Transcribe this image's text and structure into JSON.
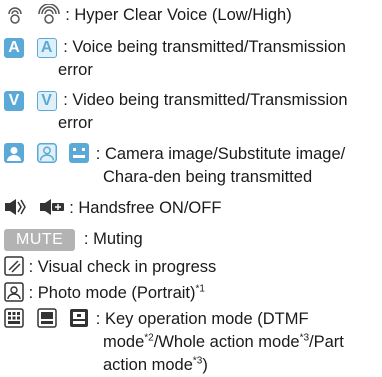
{
  "items": [
    {
      "icon_names": [
        "hyper-clear-voice-low-icon",
        "hyper-clear-voice-high-icon"
      ],
      "text": ": Hyper Clear Voice (Low/High)"
    },
    {
      "icon_names": [
        "voice-transmitted-icon",
        "transmission-error-a-icon"
      ],
      "glyph_a": "A",
      "glyph_b": "A",
      "line1": ": Voice being transmitted/Transmission",
      "line2": "error"
    },
    {
      "icon_names": [
        "video-transmitted-icon",
        "transmission-error-v-icon"
      ],
      "glyph_a": "V",
      "glyph_b": "V",
      "line1": ": Video being transmitted/Transmission",
      "line2": "error"
    },
    {
      "icon_names": [
        "camera-image-icon",
        "substitute-image-icon",
        "chara-den-icon"
      ],
      "line1": ":  Camera image/Substitute image/",
      "line2": "Chara-den being transmitted"
    },
    {
      "icon_names": [
        "handsfree-on-icon",
        "handsfree-off-icon"
      ],
      "text": ": Handsfree ON/OFF"
    },
    {
      "badge": "MUTE",
      "text": ": Muting"
    },
    {
      "icon_names": [
        "visual-check-icon"
      ],
      "text": ": Visual check in progress"
    },
    {
      "icon_names": [
        "photo-mode-portrait-icon"
      ],
      "text": ": Photo mode (Portrait)",
      "sup": "*1"
    },
    {
      "icon_names": [
        "dtmf-mode-icon",
        "whole-action-mode-icon",
        "part-action-mode-icon"
      ],
      "line1": ":  Key operation mode (DTMF",
      "line2a": "mode",
      "sup2": "*2",
      "line2b": "/Whole action mode",
      "sup3": "*3",
      "line2c": "/Part",
      "line3a": "action mode",
      "sup4": "*3",
      "line3b": ")"
    }
  ],
  "colors": {
    "accent": "#5aa9d6",
    "mute_bg": "#b3b3b3",
    "text": "#1a1a1a"
  }
}
